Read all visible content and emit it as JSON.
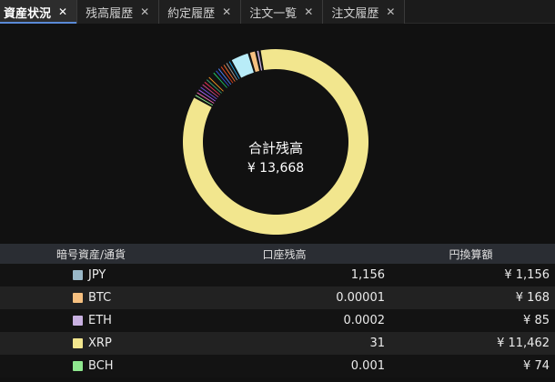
{
  "tabs": [
    {
      "label": "資産状況",
      "active": true
    },
    {
      "label": "残高履歴",
      "active": false
    },
    {
      "label": "約定履歴",
      "active": false
    },
    {
      "label": "注文一覧",
      "active": false
    },
    {
      "label": "注文履歴",
      "active": false
    }
  ],
  "close_glyph": "✕",
  "summary": {
    "title": "合計残高",
    "total": "¥ 13,668"
  },
  "donut_segments": [
    {
      "color": "#f2e68e",
      "value": 11462
    },
    {
      "color": "#8fe88f",
      "value": 74
    },
    {
      "color": "#f06ab0",
      "value": 74
    },
    {
      "color": "#a05cf0",
      "value": 74
    },
    {
      "color": "#6a4ccf",
      "value": 74
    },
    {
      "color": "#d04080",
      "value": 74
    },
    {
      "color": "#e03050",
      "value": 74
    },
    {
      "color": "#3aa070",
      "value": 74
    },
    {
      "color": "#f09020",
      "value": 74
    },
    {
      "color": "#111111",
      "value": 74
    },
    {
      "color": "#20c060",
      "value": 74
    },
    {
      "color": "#3050e0",
      "value": 74
    },
    {
      "color": "#5080f0",
      "value": 74
    },
    {
      "color": "#e04020",
      "value": 74
    },
    {
      "color": "#f07030",
      "value": 74
    },
    {
      "color": "#9a9a9a",
      "value": 74
    },
    {
      "color": "#20a0e0",
      "value": 74
    },
    {
      "color": "#b8ecf8",
      "value": 450
    },
    {
      "color": "#f6c080",
      "value": 168
    },
    {
      "color": "#c8b0e0",
      "value": 85
    }
  ],
  "table": {
    "headers": [
      "暗号資産/通貨",
      "口座残高",
      "円換算額"
    ],
    "rows": [
      {
        "asset": "JPY",
        "color": "#9ab8c8",
        "balance": "1,156",
        "jpy": "¥ 1,156"
      },
      {
        "asset": "BTC",
        "color": "#f6c080",
        "balance": "0.00001",
        "jpy": "¥ 168"
      },
      {
        "asset": "ETH",
        "color": "#c8b0e0",
        "balance": "0.0002",
        "jpy": "¥ 85"
      },
      {
        "asset": "XRP",
        "color": "#f2e68e",
        "balance": "31",
        "jpy": "¥ 11,462"
      },
      {
        "asset": "BCH",
        "color": "#8fe88f",
        "balance": "0.001",
        "jpy": "¥ 74"
      }
    ]
  }
}
